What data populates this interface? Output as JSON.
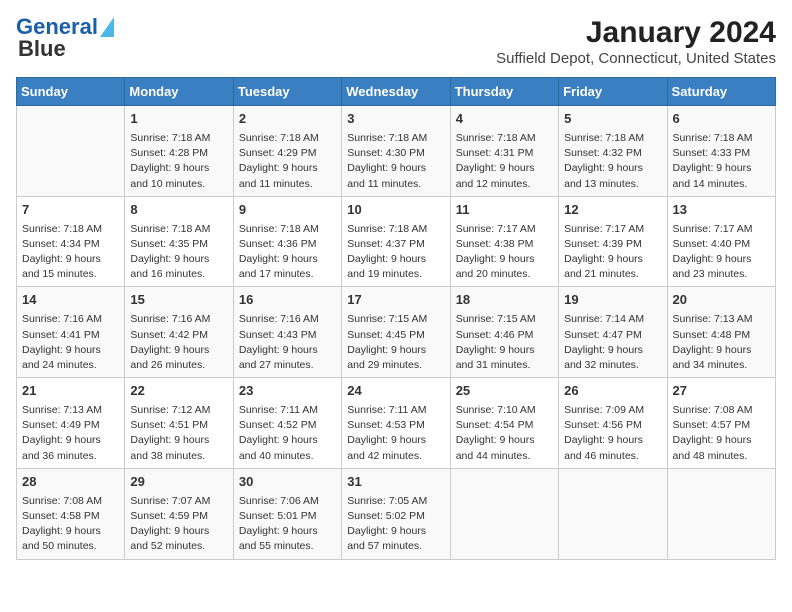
{
  "header": {
    "logo_line1": "General",
    "logo_line2": "Blue",
    "title": "January 2024",
    "subtitle": "Suffield Depot, Connecticut, United States"
  },
  "days_of_week": [
    "Sunday",
    "Monday",
    "Tuesday",
    "Wednesday",
    "Thursday",
    "Friday",
    "Saturday"
  ],
  "weeks": [
    [
      {
        "day": "",
        "sunrise": "",
        "sunset": "",
        "daylight": ""
      },
      {
        "day": "1",
        "sunrise": "Sunrise: 7:18 AM",
        "sunset": "Sunset: 4:28 PM",
        "daylight": "Daylight: 9 hours and 10 minutes."
      },
      {
        "day": "2",
        "sunrise": "Sunrise: 7:18 AM",
        "sunset": "Sunset: 4:29 PM",
        "daylight": "Daylight: 9 hours and 11 minutes."
      },
      {
        "day": "3",
        "sunrise": "Sunrise: 7:18 AM",
        "sunset": "Sunset: 4:30 PM",
        "daylight": "Daylight: 9 hours and 11 minutes."
      },
      {
        "day": "4",
        "sunrise": "Sunrise: 7:18 AM",
        "sunset": "Sunset: 4:31 PM",
        "daylight": "Daylight: 9 hours and 12 minutes."
      },
      {
        "day": "5",
        "sunrise": "Sunrise: 7:18 AM",
        "sunset": "Sunset: 4:32 PM",
        "daylight": "Daylight: 9 hours and 13 minutes."
      },
      {
        "day": "6",
        "sunrise": "Sunrise: 7:18 AM",
        "sunset": "Sunset: 4:33 PM",
        "daylight": "Daylight: 9 hours and 14 minutes."
      }
    ],
    [
      {
        "day": "7",
        "sunrise": "Sunrise: 7:18 AM",
        "sunset": "Sunset: 4:34 PM",
        "daylight": "Daylight: 9 hours and 15 minutes."
      },
      {
        "day": "8",
        "sunrise": "Sunrise: 7:18 AM",
        "sunset": "Sunset: 4:35 PM",
        "daylight": "Daylight: 9 hours and 16 minutes."
      },
      {
        "day": "9",
        "sunrise": "Sunrise: 7:18 AM",
        "sunset": "Sunset: 4:36 PM",
        "daylight": "Daylight: 9 hours and 17 minutes."
      },
      {
        "day": "10",
        "sunrise": "Sunrise: 7:18 AM",
        "sunset": "Sunset: 4:37 PM",
        "daylight": "Daylight: 9 hours and 19 minutes."
      },
      {
        "day": "11",
        "sunrise": "Sunrise: 7:17 AM",
        "sunset": "Sunset: 4:38 PM",
        "daylight": "Daylight: 9 hours and 20 minutes."
      },
      {
        "day": "12",
        "sunrise": "Sunrise: 7:17 AM",
        "sunset": "Sunset: 4:39 PM",
        "daylight": "Daylight: 9 hours and 21 minutes."
      },
      {
        "day": "13",
        "sunrise": "Sunrise: 7:17 AM",
        "sunset": "Sunset: 4:40 PM",
        "daylight": "Daylight: 9 hours and 23 minutes."
      }
    ],
    [
      {
        "day": "14",
        "sunrise": "Sunrise: 7:16 AM",
        "sunset": "Sunset: 4:41 PM",
        "daylight": "Daylight: 9 hours and 24 minutes."
      },
      {
        "day": "15",
        "sunrise": "Sunrise: 7:16 AM",
        "sunset": "Sunset: 4:42 PM",
        "daylight": "Daylight: 9 hours and 26 minutes."
      },
      {
        "day": "16",
        "sunrise": "Sunrise: 7:16 AM",
        "sunset": "Sunset: 4:43 PM",
        "daylight": "Daylight: 9 hours and 27 minutes."
      },
      {
        "day": "17",
        "sunrise": "Sunrise: 7:15 AM",
        "sunset": "Sunset: 4:45 PM",
        "daylight": "Daylight: 9 hours and 29 minutes."
      },
      {
        "day": "18",
        "sunrise": "Sunrise: 7:15 AM",
        "sunset": "Sunset: 4:46 PM",
        "daylight": "Daylight: 9 hours and 31 minutes."
      },
      {
        "day": "19",
        "sunrise": "Sunrise: 7:14 AM",
        "sunset": "Sunset: 4:47 PM",
        "daylight": "Daylight: 9 hours and 32 minutes."
      },
      {
        "day": "20",
        "sunrise": "Sunrise: 7:13 AM",
        "sunset": "Sunset: 4:48 PM",
        "daylight": "Daylight: 9 hours and 34 minutes."
      }
    ],
    [
      {
        "day": "21",
        "sunrise": "Sunrise: 7:13 AM",
        "sunset": "Sunset: 4:49 PM",
        "daylight": "Daylight: 9 hours and 36 minutes."
      },
      {
        "day": "22",
        "sunrise": "Sunrise: 7:12 AM",
        "sunset": "Sunset: 4:51 PM",
        "daylight": "Daylight: 9 hours and 38 minutes."
      },
      {
        "day": "23",
        "sunrise": "Sunrise: 7:11 AM",
        "sunset": "Sunset: 4:52 PM",
        "daylight": "Daylight: 9 hours and 40 minutes."
      },
      {
        "day": "24",
        "sunrise": "Sunrise: 7:11 AM",
        "sunset": "Sunset: 4:53 PM",
        "daylight": "Daylight: 9 hours and 42 minutes."
      },
      {
        "day": "25",
        "sunrise": "Sunrise: 7:10 AM",
        "sunset": "Sunset: 4:54 PM",
        "daylight": "Daylight: 9 hours and 44 minutes."
      },
      {
        "day": "26",
        "sunrise": "Sunrise: 7:09 AM",
        "sunset": "Sunset: 4:56 PM",
        "daylight": "Daylight: 9 hours and 46 minutes."
      },
      {
        "day": "27",
        "sunrise": "Sunrise: 7:08 AM",
        "sunset": "Sunset: 4:57 PM",
        "daylight": "Daylight: 9 hours and 48 minutes."
      }
    ],
    [
      {
        "day": "28",
        "sunrise": "Sunrise: 7:08 AM",
        "sunset": "Sunset: 4:58 PM",
        "daylight": "Daylight: 9 hours and 50 minutes."
      },
      {
        "day": "29",
        "sunrise": "Sunrise: 7:07 AM",
        "sunset": "Sunset: 4:59 PM",
        "daylight": "Daylight: 9 hours and 52 minutes."
      },
      {
        "day": "30",
        "sunrise": "Sunrise: 7:06 AM",
        "sunset": "Sunset: 5:01 PM",
        "daylight": "Daylight: 9 hours and 55 minutes."
      },
      {
        "day": "31",
        "sunrise": "Sunrise: 7:05 AM",
        "sunset": "Sunset: 5:02 PM",
        "daylight": "Daylight: 9 hours and 57 minutes."
      },
      {
        "day": "",
        "sunrise": "",
        "sunset": "",
        "daylight": ""
      },
      {
        "day": "",
        "sunrise": "",
        "sunset": "",
        "daylight": ""
      },
      {
        "day": "",
        "sunrise": "",
        "sunset": "",
        "daylight": ""
      }
    ]
  ]
}
